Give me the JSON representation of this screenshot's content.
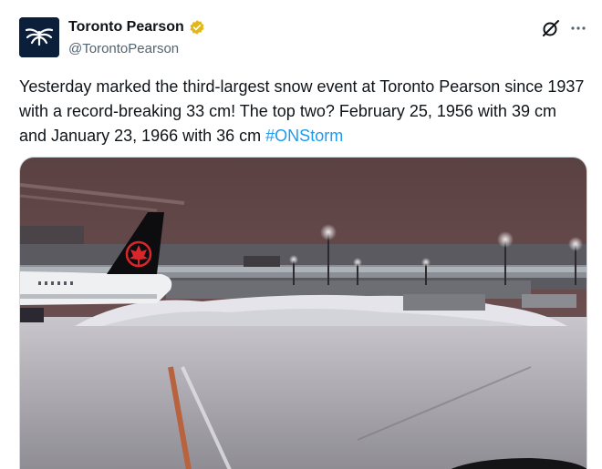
{
  "author": {
    "display_name": "Toronto Pearson",
    "handle": "@TorontoPearson",
    "verified": true,
    "verified_color": "#e2b719",
    "avatar_icon": "toronto-pearson-logo-icon"
  },
  "actions": {
    "grok_icon": "grok-icon",
    "more_icon": "more-options-icon"
  },
  "tweet": {
    "text_before_hashtag": "Yesterday marked the third-largest snow event at Toronto Pearson since 1937 with a record-breaking 33 cm! The top two? February 25, 1956 with 39 cm and January 23, 1966 with 36 cm ",
    "hashtag": "#ONStorm",
    "hashtag_color": "#1d9bf0"
  },
  "media": {
    "type": "photo",
    "subject": "snowy airport apron at night",
    "tail_fin_logo": "air-canada-maple-leaf"
  }
}
